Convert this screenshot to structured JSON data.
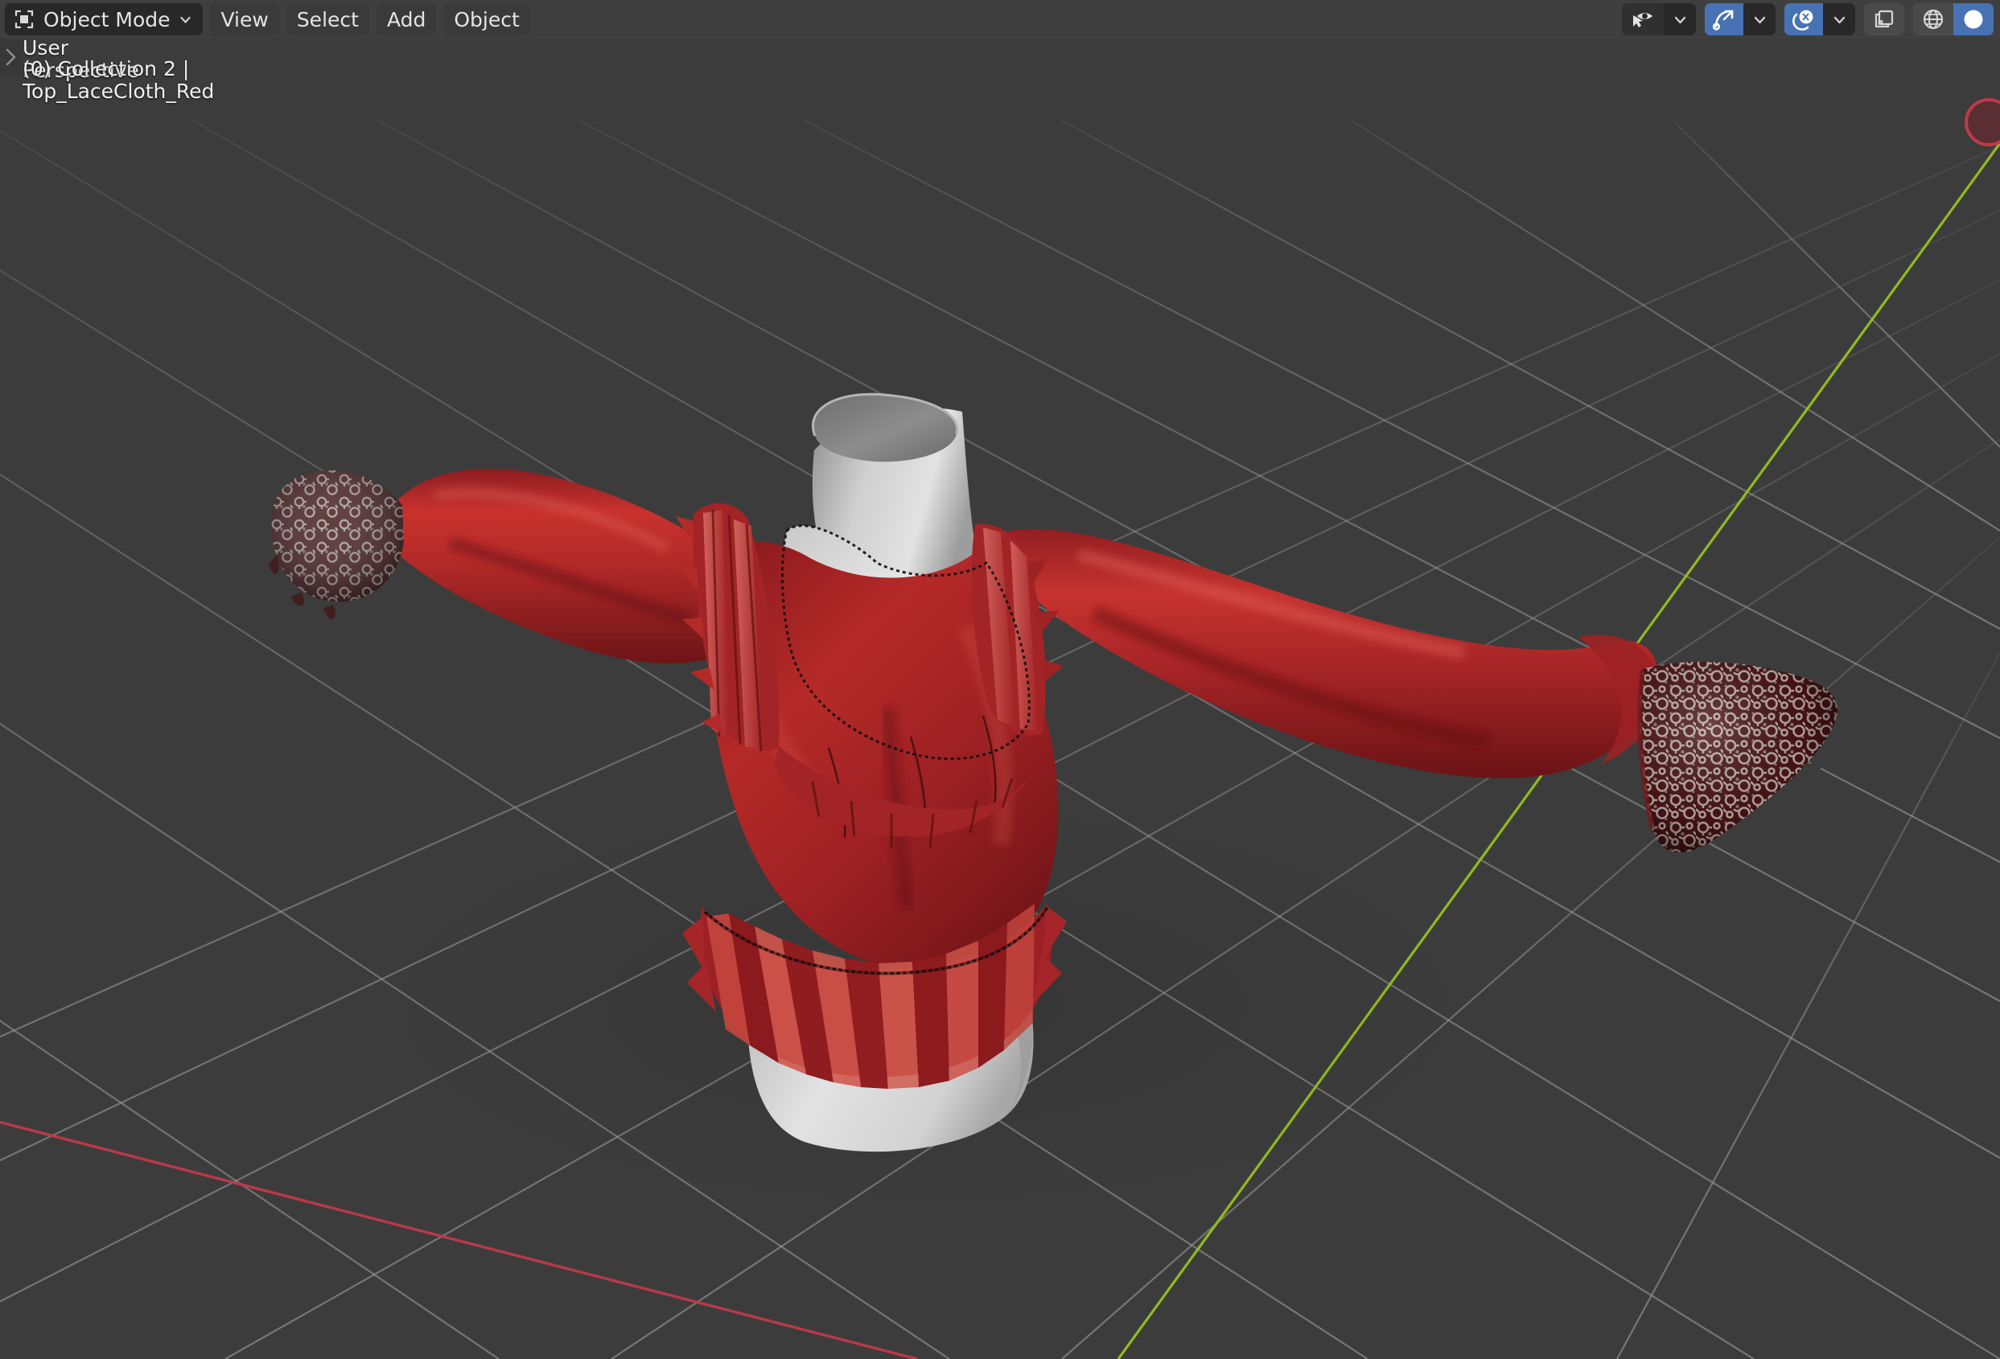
{
  "app": {
    "name": "Blender",
    "editor": "3D Viewport"
  },
  "header": {
    "mode_selector": {
      "icon": "object-mode-icon",
      "label": "Object Mode",
      "dropdown_icon": "chevron-down-icon"
    },
    "menus": [
      {
        "label": "View",
        "name": "view"
      },
      {
        "label": "Select",
        "name": "select"
      },
      {
        "label": "Add",
        "name": "add"
      },
      {
        "label": "Object",
        "name": "object"
      }
    ],
    "tools": [
      {
        "name": "visibility-selectability",
        "icon": "eye-cursor-icon",
        "active": false,
        "has_dropdown": true
      },
      {
        "name": "snap",
        "icon": "magnet-snap-icon",
        "active": true,
        "has_dropdown": true
      },
      {
        "name": "proportional-editing",
        "icon": "proportional-editing-icon",
        "active": true,
        "has_dropdown": true
      },
      {
        "name": "toggle-xray",
        "icon": "xray-icon",
        "active": false,
        "has_dropdown": false
      }
    ],
    "shading_modes": [
      {
        "name": "wireframe-shading",
        "icon": "wireframe-globe-icon",
        "active": false
      },
      {
        "name": "solid-shading",
        "icon": "solid-sphere-icon",
        "active": true
      }
    ]
  },
  "viewport_overlay": {
    "sidebar_toggle_icon": "chevron-right-icon",
    "perspective_label": "User Perspective",
    "active_object_label": "(0) Collection 2 | Top_LaceCloth_Red",
    "frame_number": "(0)",
    "collection_name": "Collection 2",
    "object_name": "Top_LaceCloth_Red"
  },
  "scene": {
    "background_color": "#3c3c3c",
    "grid_color": "#9a9a9a",
    "axis_x_color": "#c0394b",
    "axis_y_color": "#97c11f",
    "mannequin_color": "#d4d4d4",
    "garment_color": "#a61f23",
    "garment_highlight": "#c8312f",
    "lace_color": "#b8aba6",
    "lace_base_color": "#5c1a1c",
    "objects": [
      {
        "name": "Mannequin_Torso",
        "material": "grey-matte"
      },
      {
        "name": "Top_LaceCloth_Red",
        "material": "red-fabric",
        "selected": true
      },
      {
        "name": "Lace_Cuff_Left",
        "material": "lace-texture"
      },
      {
        "name": "Lace_Cuff_Right",
        "material": "lace-texture"
      }
    ]
  },
  "nav_gizmo": {
    "name": "view-axis-gizmo",
    "visible_axis": "-X",
    "color": "#8a3a42"
  }
}
